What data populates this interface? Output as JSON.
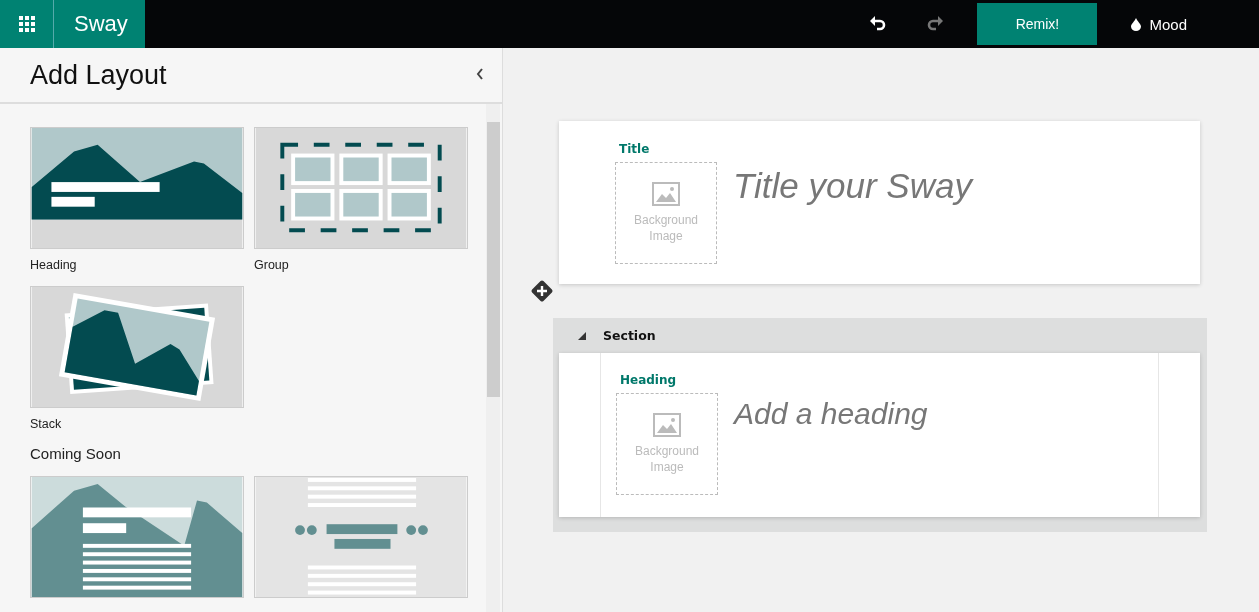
{
  "top_bar": {
    "app_name": "Sway",
    "undo": {
      "disabled": false
    },
    "redo": {
      "disabled": true
    },
    "remix_button": "Remix!",
    "mood_button": "Mood"
  },
  "panel": {
    "title": "Add Layout",
    "layouts": [
      {
        "kind": "heading",
        "label": "Heading"
      },
      {
        "kind": "group",
        "label": "Group"
      },
      {
        "kind": "stack",
        "label": "Stack"
      }
    ],
    "coming_soon_heading": "Coming Soon",
    "coming_soon": [
      {
        "kind": "overlay"
      },
      {
        "kind": "quote"
      }
    ]
  },
  "canvas": {
    "title_card": {
      "label": "Title",
      "image_placeholder": "Background Image",
      "placeholder": "Title your Sway"
    },
    "section": {
      "label": "Section",
      "expanded": true,
      "card": {
        "label": "Heading",
        "image_placeholder": "Background Image",
        "placeholder": "Add a heading"
      }
    }
  }
}
